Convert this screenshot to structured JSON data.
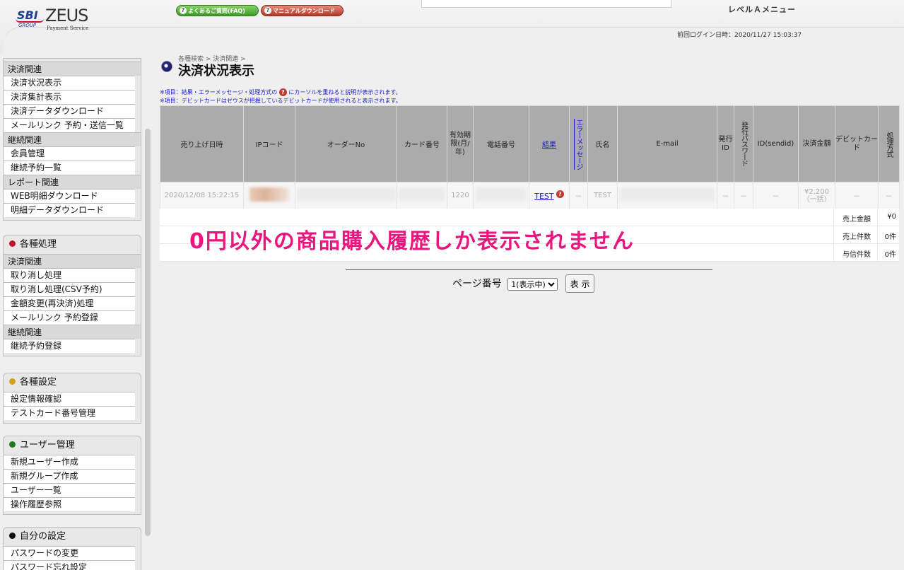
{
  "header": {
    "logo": {
      "sbi": "SBI",
      "group": "GROUP",
      "zeus": "ZEUS",
      "ps": "Payment Service"
    },
    "faq_label": "よくあるご質問(FAQ)",
    "manual_label": "マニュアルダウンロード",
    "level_menu": "レベルＡメニュー",
    "last_login": "前回ログイン日時：2020/11/27 15:03:37"
  },
  "sidebar": {
    "top": {
      "cats": [
        {
          "label": "決済関連",
          "items": [
            "決済状況表示",
            "決済集計表示",
            "決済データダウンロード",
            "メールリンク 予約・送信一覧"
          ]
        },
        {
          "label": "継続関連",
          "items": [
            "会員管理",
            "継続予約一覧"
          ]
        },
        {
          "label": "レポート関連",
          "items": [
            "WEB明細ダウンロード",
            "明細データダウンロード"
          ]
        }
      ]
    },
    "kakushu": {
      "title": "各種処理",
      "dot": "#c8102e",
      "cats": [
        {
          "label": "決済関連",
          "items": [
            "取り消し処理",
            "取り消し処理(CSV予約)",
            "金額変更(再決済)処理",
            "メールリンク 予約登録"
          ]
        },
        {
          "label": "継続関連",
          "items": [
            "継続予約登録"
          ]
        }
      ]
    },
    "settei": {
      "title": "各種設定",
      "dot": "#d4a017",
      "items": [
        "設定情報確認",
        "テストカード番号管理"
      ]
    },
    "user": {
      "title": "ユーザー管理",
      "dot": "#1f7a1f",
      "items": [
        "新規ユーザー作成",
        "新規グループ作成",
        "ユーザー一覧",
        "操作履歴参照"
      ]
    },
    "self": {
      "title": "自分の設定",
      "dot": "#111111",
      "items": [
        "パスワードの変更",
        "パスワード忘れ設定"
      ]
    }
  },
  "main": {
    "breadcrumb": "各種検索 > 決済関連 >",
    "title": "決済状況表示",
    "note1_pre": "※項目：結果・エラーメッセージ・処理方式の",
    "note1_post": "にカーソルを重ねると説明が表示されます。",
    "note2": "※項目：デビットカードはゼウスが把握しているデビットカードが使用されると表示されます。",
    "help_glyph": "?",
    "columns": {
      "date": "売り上げ日時",
      "ip": "IPコード",
      "order": "オーダーNo",
      "card": "カード番号",
      "expiry": "有効期限(月/年)",
      "phone": "電話番号",
      "result": "結果",
      "errmsg": "エラーメッセージ",
      "name": "氏名",
      "email": "E-mail",
      "issue_id": "発行ID",
      "issue_pw": "発行パスワード",
      "sendid": "ID(sendid)",
      "amount": "決済金額",
      "debit": "デビットカード",
      "method": "処理方式"
    },
    "row": {
      "date": "2020/12/08 15:22:15",
      "expiry": "1220",
      "result": "TEST",
      "dash": "－",
      "name": "TEST",
      "amount_line1": "¥2,200",
      "amount_line2": "（一括）"
    },
    "totals": [
      {
        "label": "売上金額",
        "value": "¥0"
      },
      {
        "label": "売上件数",
        "value": "0件"
      },
      {
        "label": "与信件数",
        "value": "0件"
      }
    ],
    "overlay": "0円以外の商品購入履歴しか表示されません",
    "pager": {
      "label": "ページ番号",
      "option": "1(表示中)",
      "button": "表 示"
    }
  }
}
